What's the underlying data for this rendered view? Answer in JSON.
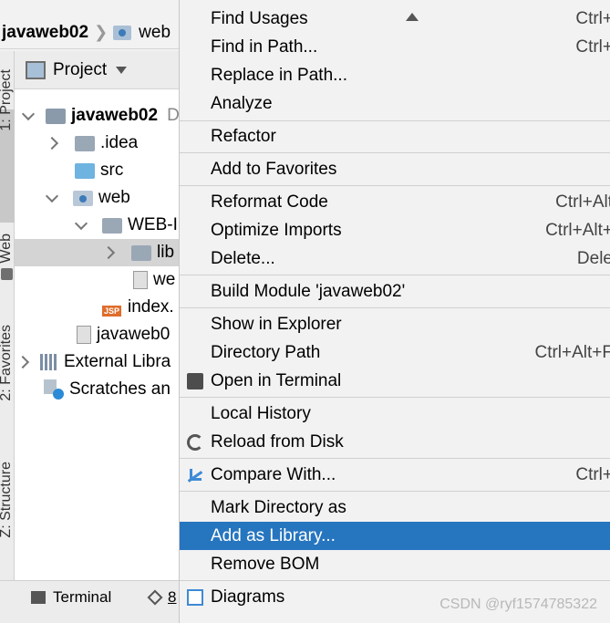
{
  "breadcrumb": {
    "project": "javaweb02",
    "folder": "web"
  },
  "toolstrip": {
    "project_label": "1: Project",
    "web_label": "Web",
    "favorites_label": "2: Favorites",
    "structure_label": "Z: Structure"
  },
  "panel": {
    "title": "Project",
    "tree": [
      {
        "label": "javaweb02",
        "suffix": "D",
        "kind": "project",
        "expand": "down"
      },
      {
        "label": ".idea",
        "kind": "folder",
        "expand": "right"
      },
      {
        "label": "src",
        "kind": "src-folder",
        "expand": ""
      },
      {
        "label": "web",
        "kind": "web-folder",
        "expand": "down"
      },
      {
        "label": "WEB-I",
        "kind": "folder",
        "expand": "down"
      },
      {
        "label": "lib",
        "kind": "folder",
        "expand": "right"
      },
      {
        "label": "we",
        "kind": "xml-file",
        "expand": ""
      },
      {
        "label": "index.",
        "kind": "jsp-file",
        "expand": ""
      },
      {
        "label": "javaweb0",
        "kind": "iml-file",
        "expand": ""
      },
      {
        "label": "External Libra",
        "kind": "libraries",
        "expand": "right"
      },
      {
        "label": "Scratches an",
        "kind": "scratches",
        "expand": ""
      }
    ]
  },
  "bottombar": {
    "terminal": "Terminal",
    "next": "8"
  },
  "menu": {
    "items": [
      {
        "label": "Find Usages",
        "shortcut": "Ctrl+"
      },
      {
        "label": "Find in Path...",
        "shortcut": "Ctrl+"
      },
      {
        "label": "Replace in Path...",
        "shortcut": ""
      },
      {
        "label": "Analyze",
        "shortcut": ""
      },
      {
        "label": "Refactor",
        "shortcut": ""
      },
      {
        "label": "Add to Favorites",
        "shortcut": ""
      },
      {
        "label": "Reformat Code",
        "shortcut": "Ctrl+Alt"
      },
      {
        "label": "Optimize Imports",
        "shortcut": "Ctrl+Alt+"
      },
      {
        "label": "Delete...",
        "shortcut": "Dele"
      },
      {
        "label": "Build Module 'javaweb02'",
        "shortcut": ""
      },
      {
        "label": "Show in Explorer",
        "shortcut": ""
      },
      {
        "label": "Directory Path",
        "shortcut": "Ctrl+Alt+F"
      },
      {
        "label": "Open in Terminal",
        "shortcut": ""
      },
      {
        "label": "Local History",
        "shortcut": ""
      },
      {
        "label": "Reload from Disk",
        "shortcut": ""
      },
      {
        "label": "Compare With...",
        "shortcut": "Ctrl+"
      },
      {
        "label": "Mark Directory as",
        "shortcut": ""
      },
      {
        "label": "Add as Library...",
        "shortcut": ""
      },
      {
        "label": "Remove BOM",
        "shortcut": ""
      },
      {
        "label": "Diagrams",
        "shortcut": ""
      }
    ],
    "highlighted": "Add as Library...",
    "highlight_color": "#2675bf"
  },
  "watermark": "CSDN @ryf1574785322"
}
